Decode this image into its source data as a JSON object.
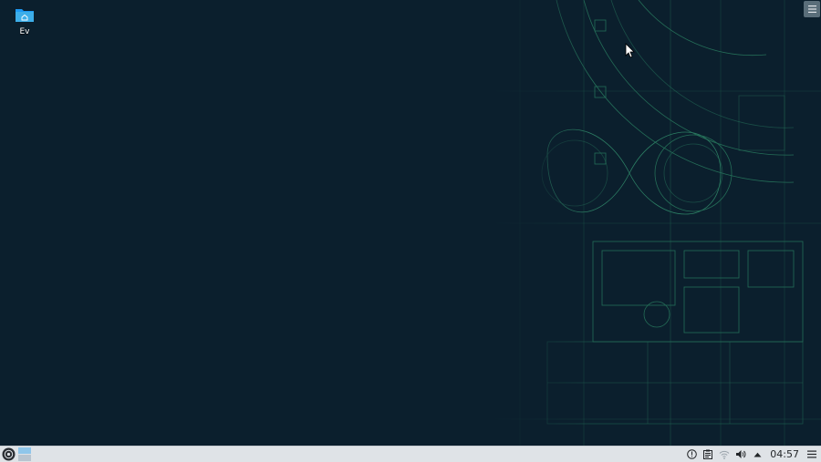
{
  "desktop": {
    "icons": [
      {
        "label": "Ev",
        "icon": "home-folder-icon"
      }
    ]
  },
  "taskbar": {
    "launcher_icon": "application-launcher-icon",
    "pager": {
      "desktops": 2,
      "active_index": 0
    },
    "tray": {
      "icons": [
        "info-icon",
        "clipboard-icon",
        "wifi-icon",
        "volume-icon",
        "expand-arrow-icon"
      ],
      "clock": "04:57",
      "menu_icon": "hamburger-menu-icon"
    }
  },
  "colors": {
    "desktop_bg": "#0b1f2d",
    "wallpaper_lines": "#2f8f6a",
    "taskbar_bg": "#dfe3e7",
    "folder_blue": "#3daee9",
    "pager_active": "#8fc6ea"
  }
}
